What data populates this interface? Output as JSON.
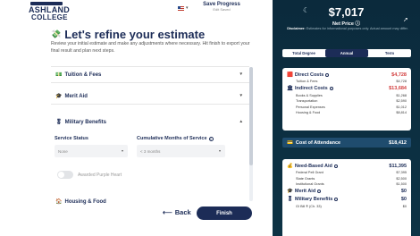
{
  "logo": {
    "line1": "ASHLAND",
    "line2": "COLLEGE"
  },
  "header": {
    "save_label": "Save Progress",
    "save_sub": "Edit Saved",
    "lang_chevron": "▾"
  },
  "page": {
    "title": "Let's refine your estimate",
    "subtitle": "Review your initial estimate and make any adjustments where necessary. Hit finish to export your final result and plan next steps."
  },
  "sections": [
    {
      "label": "Tuition & Fees",
      "icon": "dollar-icon"
    },
    {
      "label": "Merit Aid",
      "icon": "graduation-cap-icon"
    },
    {
      "label": "Military Benefits",
      "icon": "medal-icon"
    },
    {
      "label": "Housing & Food",
      "icon": "house-icon"
    }
  ],
  "military": {
    "service_status_label": "Service Status",
    "service_status_value": "None",
    "months_label": "Cumulative Months of Service",
    "months_placeholder": "< 3 months",
    "purple_heart_label": "Awarded Purple Heart"
  },
  "nav": {
    "back_label": "Back",
    "finish_label": "Finish"
  },
  "summary": {
    "net_price": "$7,017",
    "net_price_label": "Net Price",
    "disclaimer_bold": "Disclaimer:",
    "disclaimer": "Estimates for informational purposes only. Actual amount may differ.",
    "tabs": [
      {
        "label": "Total Degree",
        "active": false
      },
      {
        "label": "Annual",
        "active": true
      },
      {
        "label": "Term",
        "active": false
      }
    ],
    "direct_costs": {
      "label": "Direct Costs",
      "value": "$4,728"
    },
    "direct_items": [
      {
        "label": "Tuition & Fees",
        "value": "$4,728"
      }
    ],
    "indirect_costs": {
      "label": "Indirect Costs",
      "value": "$13,684"
    },
    "indirect_items": [
      {
        "label": "Books & Supplies",
        "value": "$1,268"
      },
      {
        "label": "Transportation",
        "value": "$2,590"
      },
      {
        "label": "Personal Expenses",
        "value": "$1,012"
      },
      {
        "label": "Housing & Food",
        "value": "$8,814"
      }
    ],
    "coa": {
      "label": "Cost of Attendance",
      "value": "$18,412"
    },
    "need_aid": {
      "label": "Need-Based Aid",
      "value": "$11,395"
    },
    "need_items": [
      {
        "label": "Federal Pell Grant",
        "value": "$7,395"
      },
      {
        "label": "State Grants",
        "value": "$2,500"
      },
      {
        "label": "Institutional Grants",
        "value": "$1,500"
      }
    ],
    "merit_aid": {
      "label": "Merit Aid",
      "value": "$0"
    },
    "military_benefits": {
      "label": "Military Benefits",
      "value": "$0"
    },
    "military_items": [
      {
        "label": "GI Bill ® (Ch. 33)",
        "value": "$0"
      }
    ]
  },
  "colors": {
    "navy": "#1c2c57",
    "panel": "#0b2a3c",
    "negative": "#d23e3e"
  }
}
